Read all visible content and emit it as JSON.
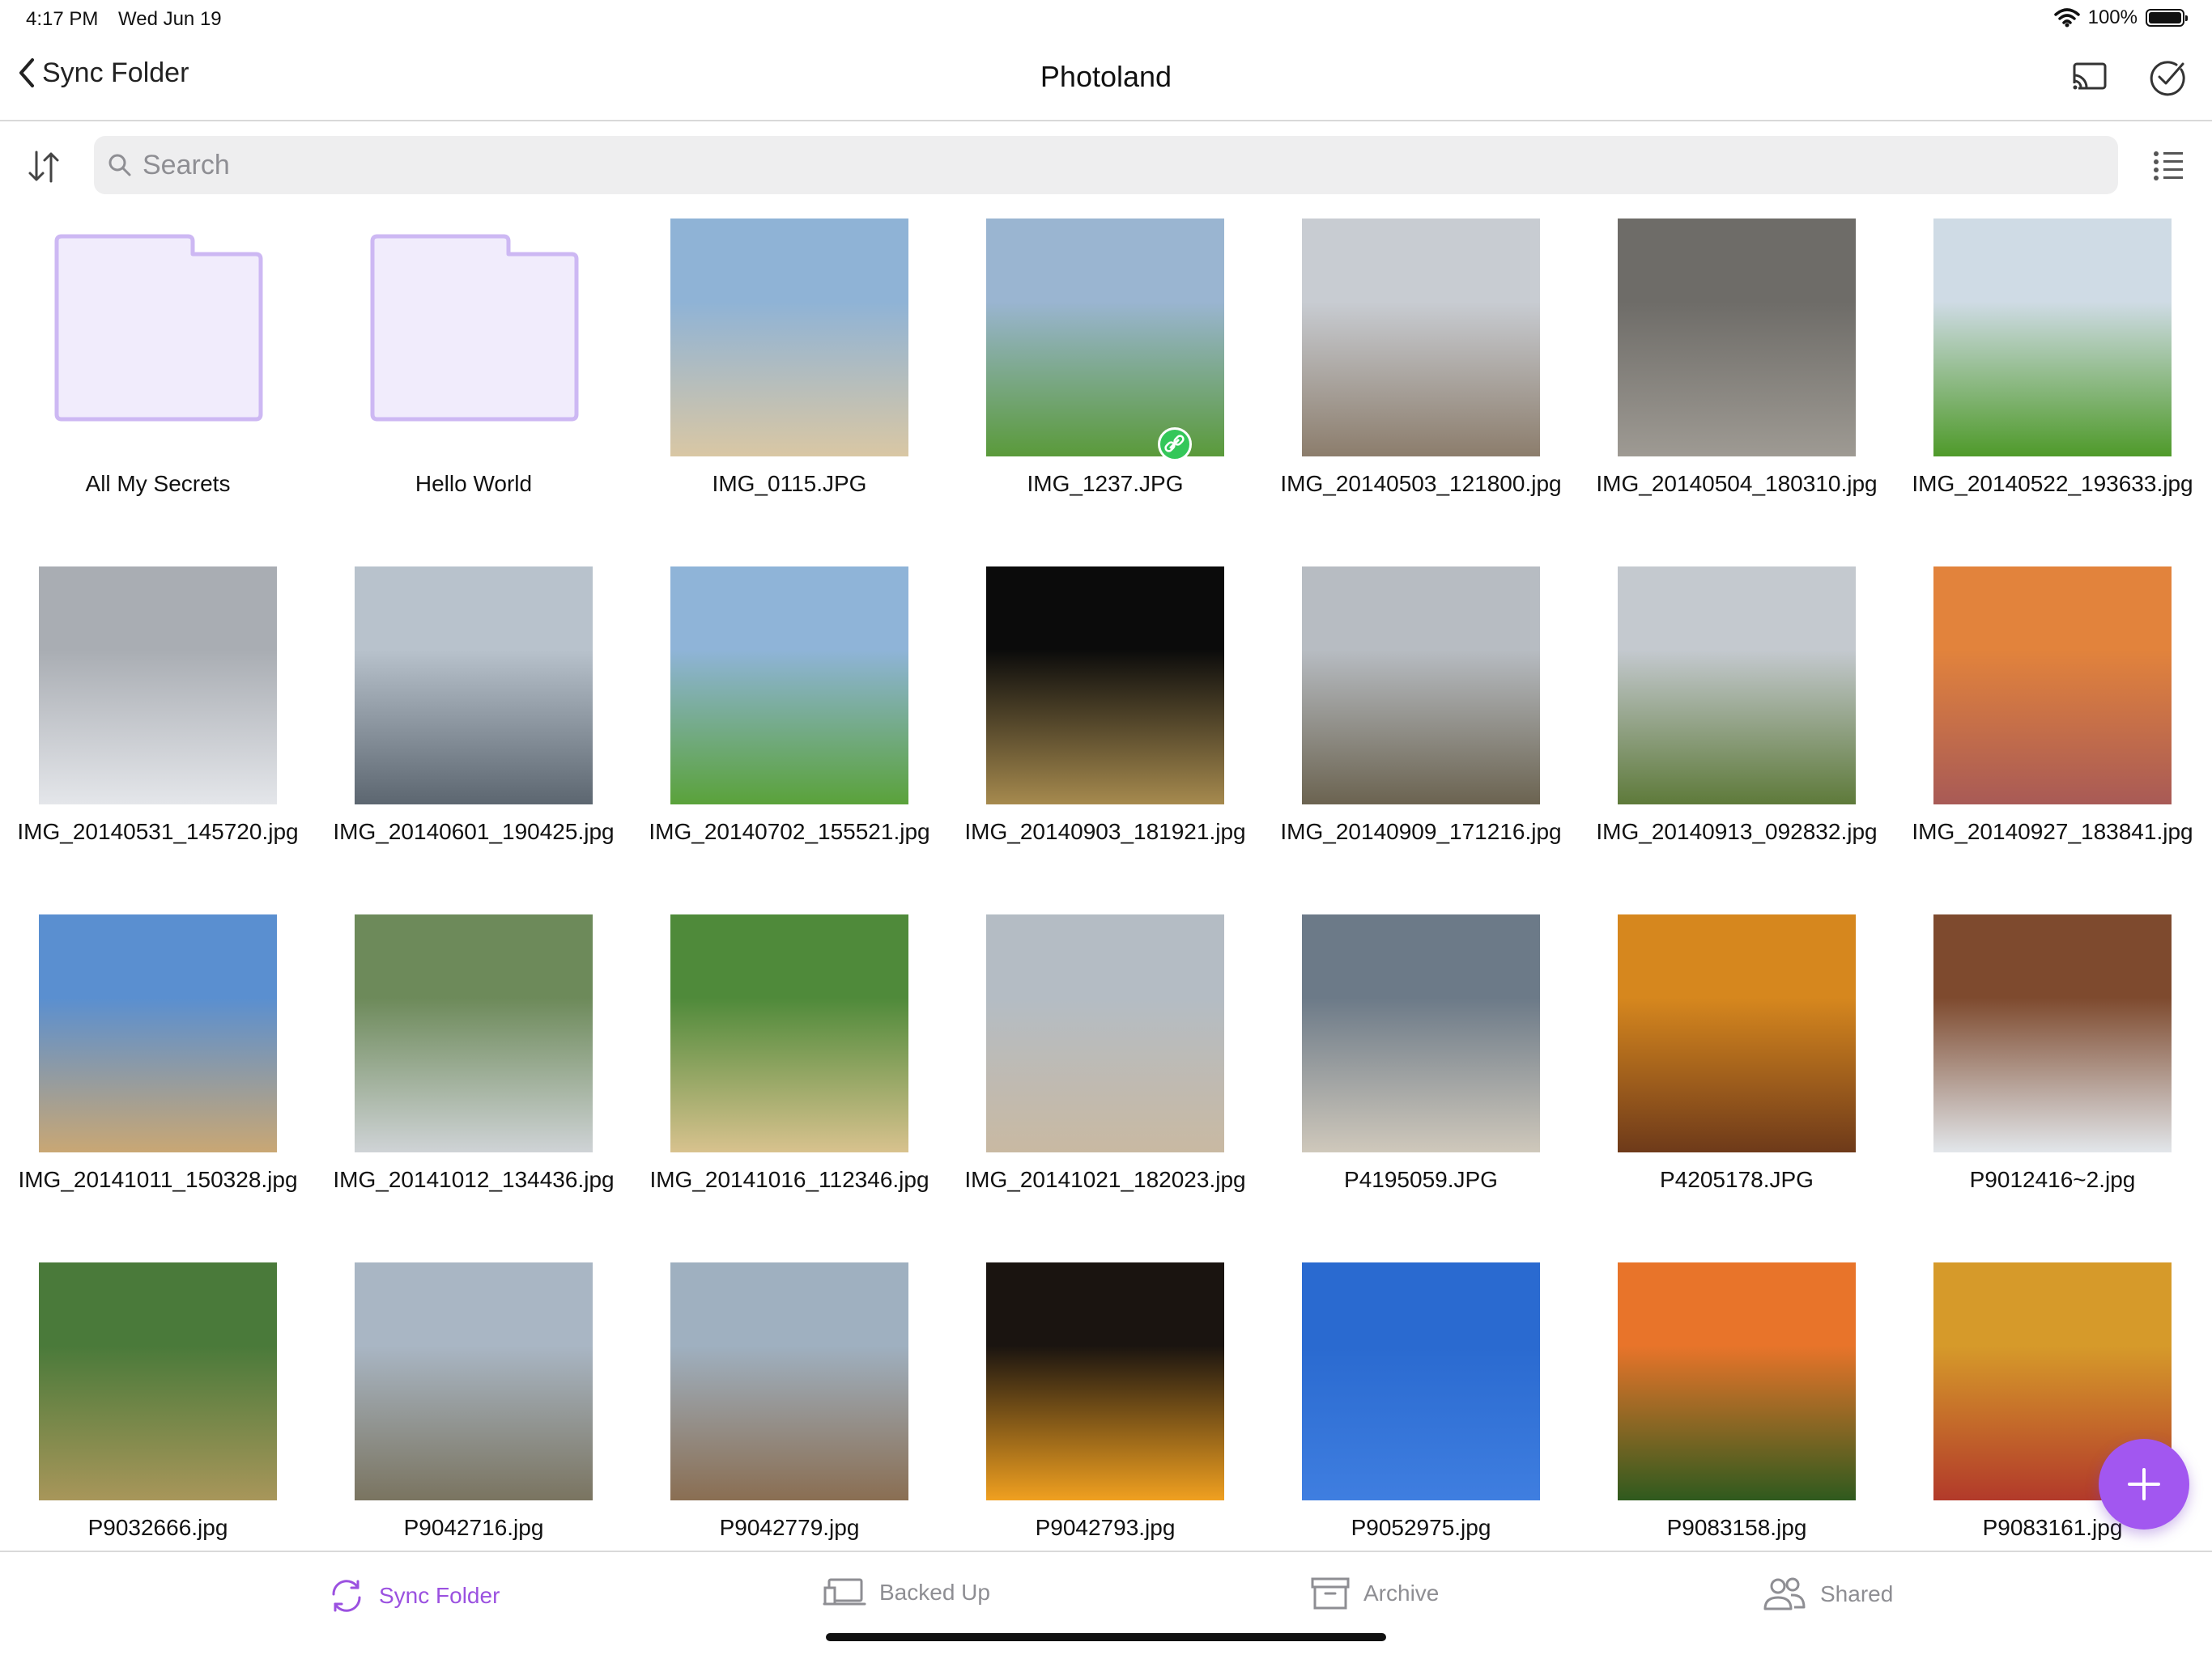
{
  "status": {
    "time": "4:17 PM",
    "date": "Wed Jun 19",
    "battery": "100%"
  },
  "nav": {
    "back_label": "Sync Folder",
    "title": "Photoland"
  },
  "search": {
    "placeholder": "Search",
    "value": ""
  },
  "items": [
    {
      "label": "All My Secrets",
      "kind": "folder"
    },
    {
      "label": "Hello World",
      "kind": "folder"
    },
    {
      "label": "IMG_0115.JPG",
      "kind": "photo",
      "colors": [
        "#8fb3d6",
        "#d9c7a4"
      ]
    },
    {
      "label": "IMG_1237.JPG",
      "kind": "photo",
      "colors": [
        "#9ab5d1",
        "#5a9a3a"
      ],
      "linked": true
    },
    {
      "label": "IMG_20140503_121800.jpg",
      "kind": "photo",
      "colors": [
        "#c8ccd2",
        "#8c7d6c"
      ]
    },
    {
      "label": "IMG_20140504_180310.jpg",
      "kind": "photo",
      "colors": [
        "#6e6c68",
        "#9e9a93"
      ]
    },
    {
      "label": "IMG_20140522_193633.jpg",
      "kind": "photo",
      "colors": [
        "#cfdbe5",
        "#4f9a2a"
      ]
    },
    {
      "label": "IMG_20140531_145720.jpg",
      "kind": "photo",
      "colors": [
        "#a9adb3",
        "#e4e6ea"
      ]
    },
    {
      "label": "IMG_20140601_190425.jpg",
      "kind": "photo",
      "colors": [
        "#b8c2cc",
        "#5c6670"
      ]
    },
    {
      "label": "IMG_20140702_155521.jpg",
      "kind": "photo",
      "colors": [
        "#8fb4d8",
        "#5aa23a"
      ]
    },
    {
      "label": "IMG_20140903_181921.jpg",
      "kind": "photo",
      "colors": [
        "#0b0b0b",
        "#a68a4e"
      ]
    },
    {
      "label": "IMG_20140909_171216.jpg",
      "kind": "photo",
      "colors": [
        "#b7bcc2",
        "#6b6350"
      ]
    },
    {
      "label": "IMG_20140913_092832.jpg",
      "kind": "photo",
      "colors": [
        "#c4c9cf",
        "#5e7a3a"
      ]
    },
    {
      "label": "IMG_20140927_183841.jpg",
      "kind": "photo",
      "colors": [
        "#e2833c",
        "#a85a56"
      ]
    },
    {
      "label": "IMG_20141011_150328.jpg",
      "kind": "photo",
      "colors": [
        "#5a8fd0",
        "#c9a774"
      ]
    },
    {
      "label": "IMG_20141012_134436.jpg",
      "kind": "photo",
      "colors": [
        "#6d8a5a",
        "#cfd3d6"
      ]
    },
    {
      "label": "IMG_20141016_112346.jpg",
      "kind": "photo",
      "colors": [
        "#4f8a3a",
        "#d8c28e"
      ]
    },
    {
      "label": "IMG_20141021_182023.jpg",
      "kind": "photo",
      "colors": [
        "#b4bcc4",
        "#c9b9a2"
      ]
    },
    {
      "label": "P4195059.JPG",
      "kind": "photo",
      "colors": [
        "#6c7a88",
        "#cfc8bb"
      ]
    },
    {
      "label": "P4205178.JPG",
      "kind": "photo",
      "colors": [
        "#d6871e",
        "#6e3a1a"
      ]
    },
    {
      "label": "P9012416~2.jpg",
      "kind": "photo",
      "colors": [
        "#7e4a2e",
        "#e2e6ea"
      ]
    },
    {
      "label": "P9032666.jpg",
      "kind": "photo",
      "colors": [
        "#4a7a3a",
        "#a8965a"
      ]
    },
    {
      "label": "P9042716.jpg",
      "kind": "photo",
      "colors": [
        "#a9b6c4",
        "#7a7460"
      ]
    },
    {
      "label": "P9042779.jpg",
      "kind": "photo",
      "colors": [
        "#9fb0c0",
        "#8a6e52"
      ]
    },
    {
      "label": "P9042793.jpg",
      "kind": "photo",
      "colors": [
        "#1a1410",
        "#f0a020"
      ]
    },
    {
      "label": "P9052975.jpg",
      "kind": "photo",
      "colors": [
        "#2a6ad0",
        "#3f7ee0"
      ]
    },
    {
      "label": "P9083158.jpg",
      "kind": "photo",
      "colors": [
        "#e8742a",
        "#2f5a1e"
      ]
    },
    {
      "label": "P9083161.jpg",
      "kind": "photo",
      "colors": [
        "#d69a2a",
        "#b23a2a"
      ]
    }
  ],
  "tabs": [
    {
      "label": "Sync Folder",
      "active": true
    },
    {
      "label": "Backed Up",
      "active": false
    },
    {
      "label": "Archive",
      "active": false
    },
    {
      "label": "Shared",
      "active": false
    }
  ],
  "colors": {
    "accent": "#9b51e0",
    "fab": "#a257f0",
    "folder_fill": "#f1ecfc",
    "folder_stroke": "#cdb8f3"
  }
}
